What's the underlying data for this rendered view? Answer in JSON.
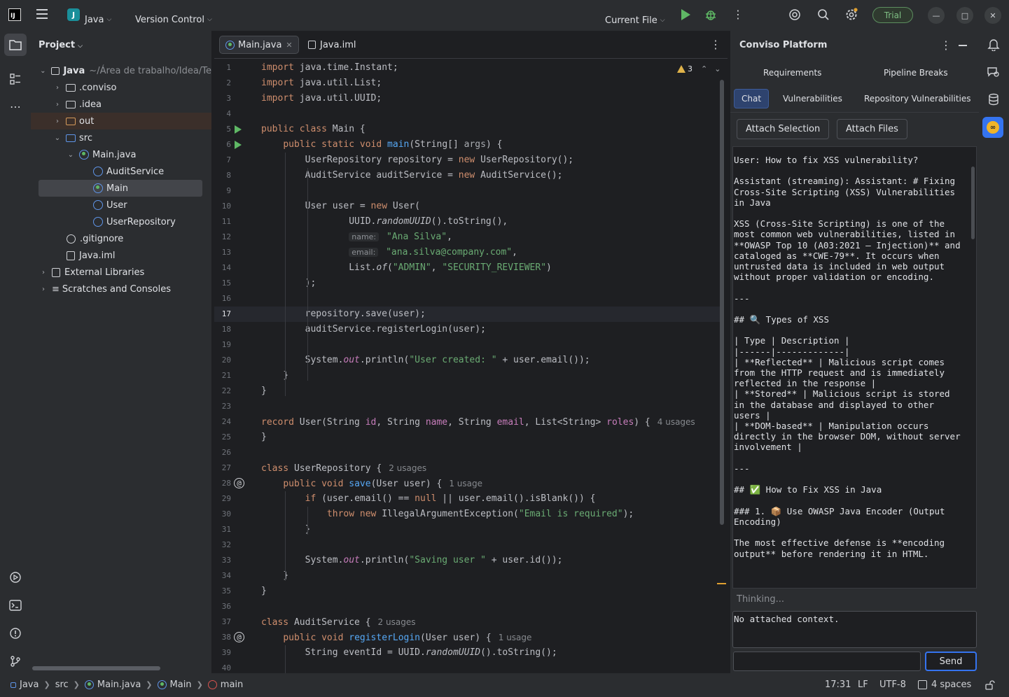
{
  "titlebar": {
    "project_badge": "J",
    "project_name": "Java",
    "vcs_label": "Version Control",
    "run_config": "Current File",
    "trial_label": "Trial"
  },
  "project_panel": {
    "title": "Project",
    "root": {
      "name": "Java",
      "path": "~/Área de trabalho/Idea/Te"
    },
    "items": [
      ".conviso",
      ".idea",
      "out",
      "src",
      "Main.java",
      "AuditService",
      "Main",
      "User",
      "UserRepository",
      ".gitignore",
      "Java.iml",
      "External Libraries",
      "Scratches and Consoles"
    ]
  },
  "editor": {
    "tabs": [
      {
        "label": "Main.java",
        "active": true
      },
      {
        "label": "Java.iml",
        "active": false
      }
    ],
    "warning_count": "3",
    "current_line": 17
  },
  "code_lines": [
    "import java.time.Instant;",
    "import java.util.List;",
    "import java.util.UUID;",
    "",
    "public class Main {",
    "    public static void main(String[] args) {",
    "        UserRepository repository = new UserRepository();",
    "        AuditService auditService = new AuditService();",
    "",
    "        User user = new User(",
    "                UUID.randomUUID().toString(),",
    "                name: \"Ana Silva\",",
    "                email: \"ana.silva@company.com\",",
    "                List.of(\"ADMIN\", \"SECURITY_REVIEWER\")",
    "        );",
    "",
    "        repository.save(user);",
    "        auditService.registerLogin(user);",
    "",
    "        System.out.println(\"User created: \" + user.email());",
    "    }",
    "}",
    "",
    "record User(String id, String name, String email, List<String> roles) {  4 usages",
    "}",
    "",
    "class UserRepository {  2 usages",
    "    public void save(User user) {  1 usage",
    "        if (user.email() == null || user.email().isBlank()) {",
    "            throw new IllegalArgumentException(\"Email is required\");",
    "        }",
    "",
    "        System.out.println(\"Saving user \" + user.id());",
    "    }",
    "}",
    "",
    "class AuditService {  2 usages",
    "    public void registerLogin(User user) {  1 usage",
    "        String eventId = UUID.randomUUID().toString();",
    ""
  ],
  "conviso": {
    "title": "Conviso Platform",
    "tabs_row1": [
      "Requirements",
      "Pipeline Breaks"
    ],
    "tabs_row2": [
      "Chat",
      "Vulnerabilities",
      "Repository Vulnerabilities"
    ],
    "attach_selection": "Attach Selection",
    "attach_files": "Attach Files",
    "chat_text": "User: How to fix XSS vulnerability?\n\nAssistant (streaming): Assistant: # Fixing Cross-Site Scripting (XSS) Vulnerabilities in Java\n\nXSS (Cross-Site Scripting) is one of the most common web vulnerabilities, listed in **OWASP Top 10 (A03:2021 – Injection)** and cataloged as **CWE-79**. It occurs when untrusted data is included in web output without proper validation or encoding.\n\n---\n\n## 🔍 Types of XSS\n\n| Type | Description |\n|------|-------------|\n| **Reflected** | Malicious script comes from the HTTP request and is immediately reflected in the response |\n| **Stored** | Malicious script is stored in the database and displayed to other users |\n| **DOM-based** | Manipulation occurs directly in the browser DOM, without server involvement |\n\n---\n\n## ✅ How to Fix XSS in Java\n\n### 1. 📦 Use OWASP Java Encoder (Output Encoding)\n\nThe most effective defense is **encoding output** before rendering it in HTML.",
    "thinking": "Thinking...",
    "context": "No attached context.",
    "send": "Send"
  },
  "statusbar": {
    "breadcrumbs": [
      "Java",
      "src",
      "Main.java",
      "Main",
      "main"
    ],
    "position": "17:31",
    "line_sep": "LF",
    "encoding": "UTF-8",
    "indent": "4 spaces"
  }
}
